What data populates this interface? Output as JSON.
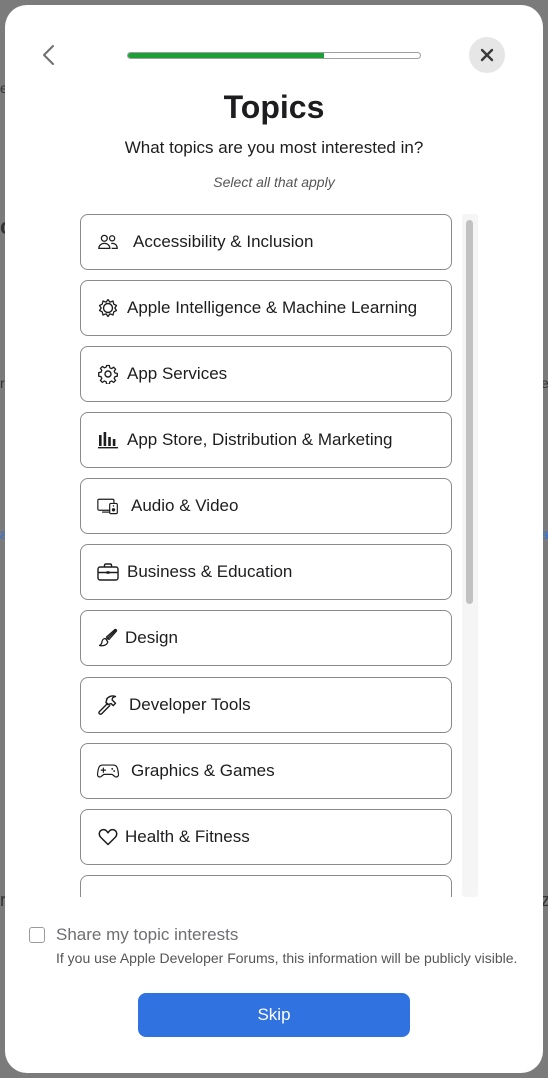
{
  "backdrop": {
    "frag_e": "e",
    "frag_c": "c",
    "frag_r": "r",
    "frag_a": "a",
    "frag_ri": "ri",
    "frag_z": "z",
    "frag_e2": "e",
    "frag_a2": "a"
  },
  "progress": {
    "value": 0.67,
    "color": "#1aa035"
  },
  "header": {
    "title": "Topics",
    "subtitle": "What topics are you most interested in?",
    "hint": "Select all that apply"
  },
  "topics": [
    {
      "label": "Accessibility & Inclusion",
      "icon": "people-icon"
    },
    {
      "label": "Apple Intelligence & Machine Learning",
      "icon": "intelligence-icon"
    },
    {
      "label": "App Services",
      "icon": "gear-icon"
    },
    {
      "label": "App Store, Distribution & Marketing",
      "icon": "chart-bars-icon"
    },
    {
      "label": "Audio & Video",
      "icon": "display-speaker-icon"
    },
    {
      "label": "Business & Education",
      "icon": "briefcase-icon"
    },
    {
      "label": "Design",
      "icon": "paintbrush-icon"
    },
    {
      "label": "Developer Tools",
      "icon": "hammer-icon"
    },
    {
      "label": "Graphics & Games",
      "icon": "gamecontroller-icon"
    },
    {
      "label": "Health & Fitness",
      "icon": "heart-icon"
    },
    {
      "label": "",
      "icon": "partial-icon"
    }
  ],
  "share": {
    "label": "Share my topic interests",
    "note": "If you use Apple Developer Forums, this information will be publicly visible.",
    "checked": false
  },
  "footer": {
    "skip_label": "Skip",
    "button_color": "#2f72e0"
  }
}
